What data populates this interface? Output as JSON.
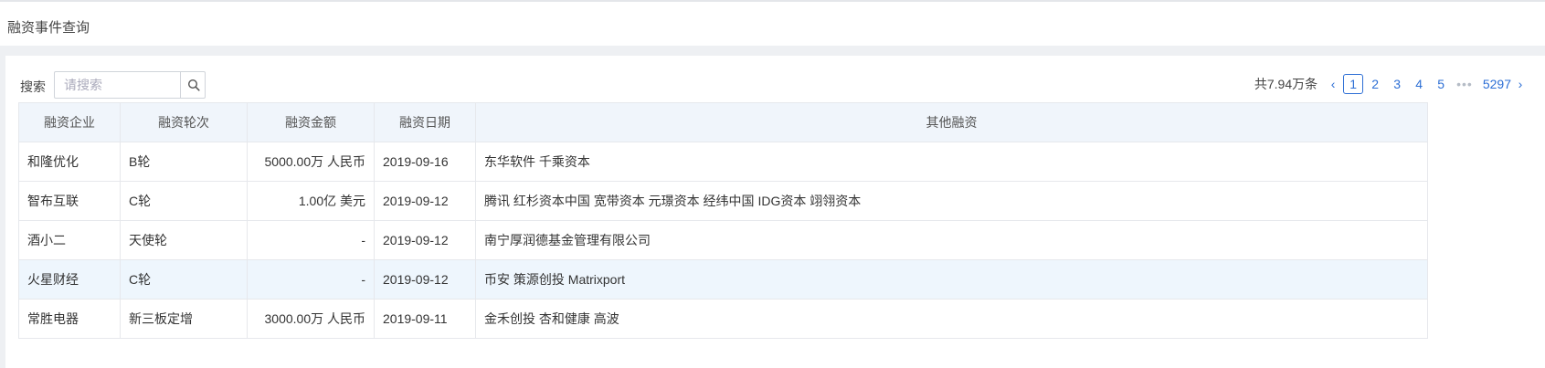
{
  "page": {
    "title": "融资事件查询"
  },
  "search": {
    "label": "搜索",
    "placeholder": "请搜索"
  },
  "pagination": {
    "total": "共7.94万条",
    "pages": [
      "1",
      "2",
      "3",
      "4",
      "5"
    ],
    "current": "1",
    "ellipsis": "•••",
    "last": "5297"
  },
  "table": {
    "columns": [
      "融资企业",
      "融资轮次",
      "融资金额",
      "融资日期",
      "其他融资"
    ],
    "rows": [
      {
        "company": "和隆优化",
        "round": "B轮",
        "amount": "5000.00万 人民币",
        "date": "2019-09-16",
        "investors": "东华软件 千乘资本"
      },
      {
        "company": "智布互联",
        "round": "C轮",
        "amount": "1.00亿 美元",
        "date": "2019-09-12",
        "investors": "腾讯 红杉资本中国 宽带资本 元璟资本 经纬中国 IDG资本 翊翎资本"
      },
      {
        "company": "酒小二",
        "round": "天使轮",
        "amount": "-",
        "date": "2019-09-12",
        "investors": "南宁厚润德基金管理有限公司"
      },
      {
        "company": "火星财经",
        "round": "C轮",
        "amount": "-",
        "date": "2019-09-12",
        "investors": "币安 策源创投 Matrixport"
      },
      {
        "company": "常胜电器",
        "round": "新三板定增",
        "amount": "3000.00万 人民币",
        "date": "2019-09-11",
        "investors": "金禾创投 杏和健康 高波"
      }
    ]
  },
  "colors": {
    "accent": "#2d6fd5",
    "header_bg": "#f0f5fb",
    "hover_row": "#eef6fd"
  }
}
